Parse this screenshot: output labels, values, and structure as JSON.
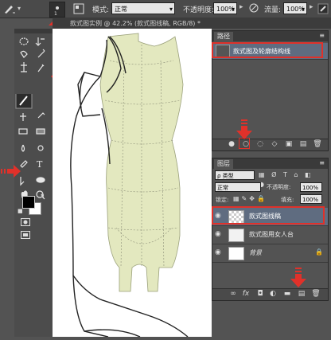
{
  "options_bar": {
    "mode_label": "模式:",
    "mode_value": "正常",
    "opacity_label": "不透明度:",
    "opacity_value": "100%",
    "flow_label": "流量:",
    "flow_value": "100%"
  },
  "document": {
    "tab_title": "款式图实例 @ 42.2% (款式图线稿, RGB/8) *"
  },
  "paths_panel": {
    "title": "路径",
    "items": [
      {
        "label": "款式图及轮廓结构线"
      }
    ]
  },
  "layers_panel": {
    "title": "图层",
    "filter_label": "ρ 类型",
    "blend_mode": "正常",
    "opacity_label": "不透明度:",
    "opacity_value": "100%",
    "lock_label": "锁定:",
    "fill_label": "填充:",
    "fill_value": "100%",
    "layers": [
      {
        "name": "款式图线稿",
        "selected": true
      },
      {
        "name": "款式图用女人台",
        "selected": false
      },
      {
        "name": "背景",
        "selected": false
      }
    ]
  },
  "colors": {
    "accent_red": "#e0312a",
    "mannequin_fill": "#e3e8bf",
    "ui_dark": "#535353"
  }
}
